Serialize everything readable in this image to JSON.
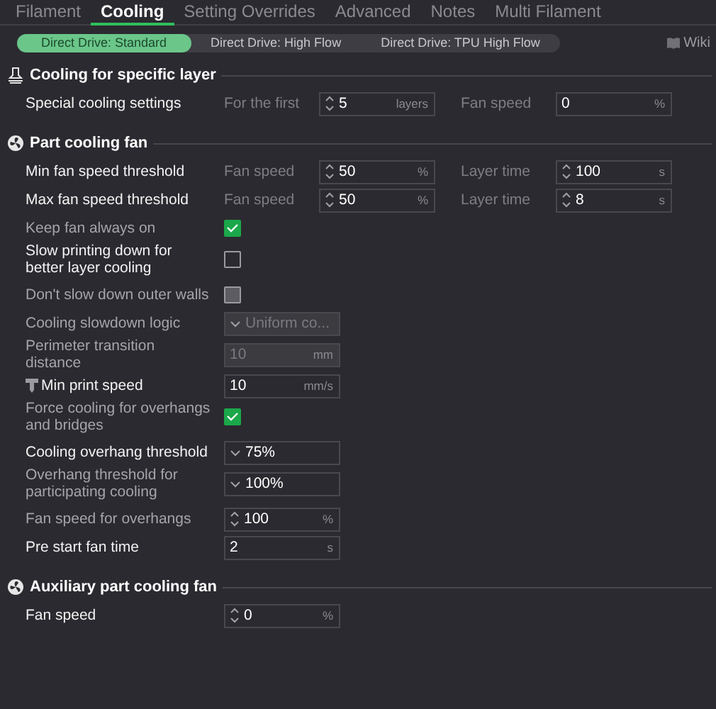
{
  "tabs": [
    {
      "label": "Filament",
      "selected": false
    },
    {
      "label": "Cooling",
      "selected": true
    },
    {
      "label": "Setting Overrides",
      "selected": false
    },
    {
      "label": "Advanced",
      "selected": false
    },
    {
      "label": "Notes",
      "selected": false
    },
    {
      "label": "Multi Filament",
      "selected": false
    }
  ],
  "presets": [
    {
      "label": "Direct Drive: Standard",
      "selected": true
    },
    {
      "label": "Direct Drive: High Flow",
      "selected": false
    },
    {
      "label": "Direct Drive: TPU High Flow",
      "selected": false
    }
  ],
  "wiki": "Wiki",
  "sections": [
    {
      "title": "Cooling for specific layer",
      "kind": "layer",
      "rows": [
        {
          "label": "Special cooling settings",
          "kind": "fields",
          "highlighted": true,
          "fields": [
            {
              "label": "For the first",
              "value": "5",
              "unit": "layers",
              "spin": true,
              "disabled": false
            },
            {
              "label": "Fan speed",
              "value": "0",
              "unit": "%",
              "spin": false,
              "disabled": false
            }
          ]
        }
      ]
    },
    {
      "title": "Part cooling fan",
      "kind": "fan",
      "rows": [
        {
          "label": "Min fan speed threshold",
          "kind": "fields",
          "highlighted": true,
          "fields": [
            {
              "label": "Fan speed",
              "value": "50",
              "unit": "%",
              "spin": true,
              "disabled": false
            },
            {
              "label": "Layer time",
              "value": "100",
              "unit": "s",
              "spin": true,
              "disabled": false
            }
          ]
        },
        {
          "label": "Max fan speed threshold",
          "kind": "fields",
          "highlighted": true,
          "fields": [
            {
              "label": "Fan speed",
              "value": "50",
              "unit": "%",
              "spin": true,
              "disabled": false
            },
            {
              "label": "Layer time",
              "value": "8",
              "unit": "s",
              "spin": true,
              "disabled": false
            }
          ]
        },
        {
          "label": "Keep fan always on",
          "kind": "checkbox",
          "highlighted": false,
          "checked": true,
          "disabled": false
        },
        {
          "label": "Slow printing down for better layer cooling",
          "kind": "checkbox",
          "highlighted": true,
          "checked": false,
          "disabled": false
        },
        {
          "label": "Don't slow down outer walls",
          "kind": "checkbox",
          "highlighted": false,
          "checked": false,
          "disabled": true
        },
        {
          "label": "Cooling slowdown logic",
          "kind": "dropdown",
          "highlighted": false,
          "value": "Uniform co...",
          "disabled": true
        },
        {
          "label": "Perimeter transition distance",
          "kind": "fields",
          "highlighted": false,
          "fields": [
            {
              "value": "10",
              "unit": "mm",
              "spin": false,
              "disabled": true
            }
          ]
        },
        {
          "label": "Min print speed",
          "kind": "fields",
          "highlighted": true,
          "icon": true,
          "fields": [
            {
              "value": "10",
              "unit": "mm/s",
              "spin": false,
              "disabled": false
            }
          ]
        },
        {
          "label": "Force cooling for overhangs and bridges",
          "kind": "checkbox",
          "highlighted": false,
          "checked": true,
          "disabled": false
        },
        {
          "label": "Cooling overhang threshold",
          "kind": "dropdown",
          "highlighted": true,
          "value": "75%",
          "disabled": false
        },
        {
          "label": "Overhang threshold for participating cooling",
          "kind": "dropdown",
          "highlighted": false,
          "value": "100%",
          "disabled": false
        },
        {
          "label": "Fan speed for overhangs",
          "kind": "fields",
          "highlighted": false,
          "fields": [
            {
              "value": "100",
              "unit": "%",
              "spin": true,
              "disabled": false
            }
          ]
        },
        {
          "label": "Pre start fan time",
          "kind": "fields",
          "highlighted": true,
          "fields": [
            {
              "value": "2",
              "unit": "s",
              "spin": false,
              "disabled": false
            }
          ]
        }
      ]
    },
    {
      "title": "Auxiliary part cooling fan",
      "kind": "fan",
      "rows": [
        {
          "label": "Fan speed",
          "kind": "fields",
          "highlighted": true,
          "fields": [
            {
              "value": "0",
              "unit": "%",
              "spin": true,
              "disabled": false
            }
          ]
        }
      ]
    }
  ]
}
